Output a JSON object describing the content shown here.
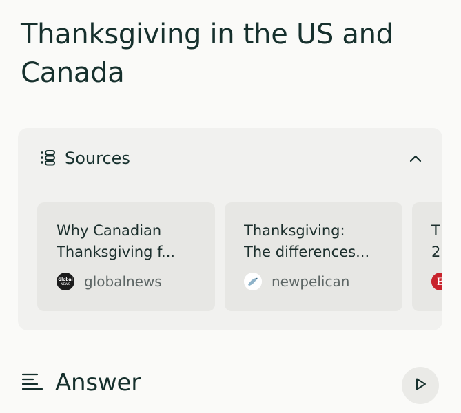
{
  "page": {
    "title": "Thanksgiving in the US and Canada"
  },
  "sources": {
    "title": "Sources",
    "icon": "list-icon",
    "toggle_icon": "chevron-up-icon",
    "cards": [
      {
        "title_line1": "Why Canadian",
        "title_line2": "Thanksgiving f...",
        "source": "globalnews",
        "favicon": "globalnews-logo",
        "favicon_text": "Global NEWS"
      },
      {
        "title_line1": "Thanksgiving:",
        "title_line2": "The differences...",
        "source": "newpelican",
        "favicon": "pelican-logo"
      },
      {
        "title_line1": "T",
        "title_line2": "2",
        "source": "",
        "favicon": "e-logo",
        "favicon_text": "E"
      }
    ]
  },
  "answer": {
    "title": "Answer",
    "icon": "text-lines-icon",
    "play_icon": "play-icon"
  },
  "colors": {
    "background": "#fafaf8",
    "panel": "#f1f1ef",
    "card": "#e7e7e4",
    "text": "#16302d",
    "muted": "#5d6665"
  }
}
